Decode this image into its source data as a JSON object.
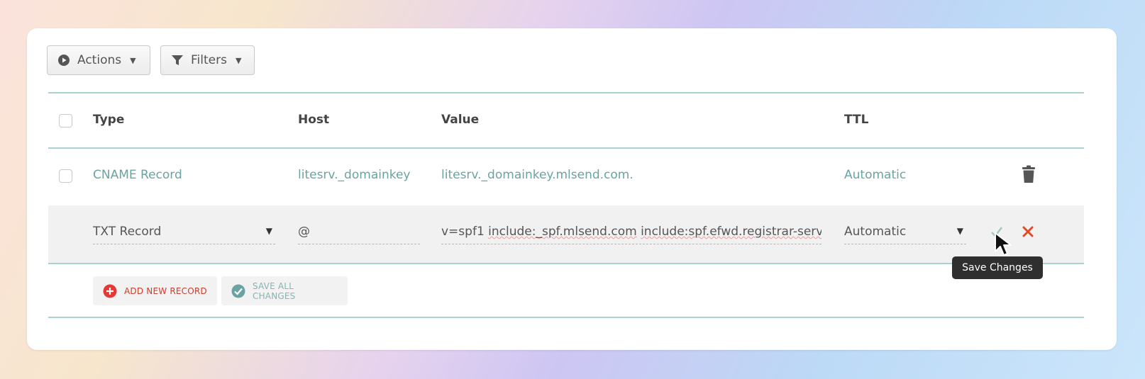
{
  "toolbar": {
    "actions_label": "Actions",
    "filters_label": "Filters"
  },
  "table": {
    "headers": {
      "type": "Type",
      "host": "Host",
      "value": "Value",
      "ttl": "TTL"
    },
    "rows": [
      {
        "type": "CNAME Record",
        "host": "litesrv._domainkey",
        "value": "litesrv._domainkey.mlsend.com.",
        "ttl": "Automatic"
      }
    ],
    "edit_row": {
      "type": "TXT Record",
      "host": "@",
      "value_prefix": "v=spf1 ",
      "value_word1": "include:_spf.mlsend.com",
      "value_sep": " ",
      "value_word2": "include:spf.efwd.registrar-servers",
      "ttl": "Automatic"
    }
  },
  "footer": {
    "add_record_label": "ADD NEW RECORD",
    "save_all_label": "SAVE ALL CHANGES"
  },
  "tooltip": {
    "text": "Save Changes"
  },
  "colors": {
    "accent_teal": "#6aa3a1",
    "divider": "#a8d2d2",
    "delete_red": "#e24a2a",
    "add_red": "#e53935"
  },
  "icons": [
    "play-circle-icon",
    "filter-icon",
    "caret-down-icon",
    "trash-icon",
    "checkmark-icon",
    "close-icon",
    "plus-circle-icon",
    "check-circle-icon",
    "mouse-pointer-icon"
  ]
}
